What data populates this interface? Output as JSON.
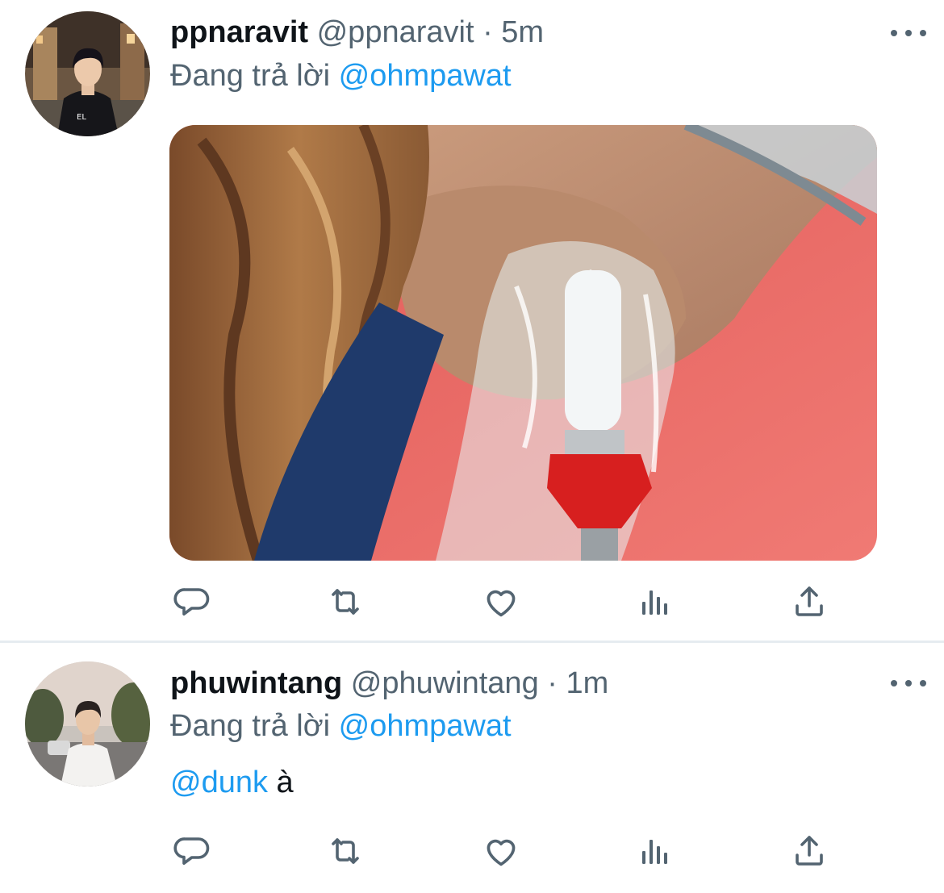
{
  "tweets": [
    {
      "display_name": "ppnaravit",
      "handle": "@ppnaravit",
      "separator": "·",
      "time": "5m",
      "reply_prefix": "Đang trả lời",
      "reply_to": "@ohmpawat",
      "has_media": true
    },
    {
      "display_name": "phuwintang",
      "handle": "@phuwintang",
      "separator": "·",
      "time": "1m",
      "reply_prefix": "Đang trả lời",
      "reply_to": "@ohmpawat",
      "text_mention": "@dunk",
      "text_rest": " à"
    }
  ],
  "actions": [
    "reply-icon",
    "retweet-icon",
    "like-icon",
    "views-icon",
    "share-icon"
  ],
  "colors": {
    "text": "#0f1419",
    "secondary": "#536471",
    "mention": "#1d9bf0",
    "divider": "#e6ecf0",
    "media_background": "#ea6a68"
  }
}
